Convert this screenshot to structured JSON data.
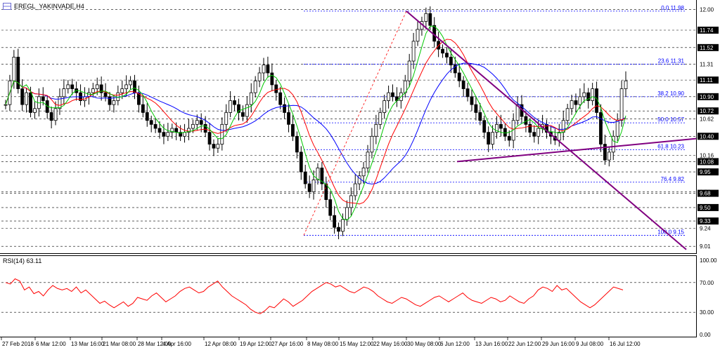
{
  "window": {
    "symbol_title": "EREGL_YAKINVADE,H4",
    "window_icon": "chart-window-icon"
  },
  "rsi": {
    "label": "RSI(14) 63.11",
    "levels": [
      {
        "text": "100.00",
        "value": 100
      },
      {
        "text": "70.00",
        "value": 70
      },
      {
        "text": "30.00",
        "value": 30
      },
      {
        "text": "0.00",
        "value": 0
      }
    ],
    "line_color": "#ff0000",
    "values": [
      70,
      68,
      75,
      72,
      60,
      64,
      55,
      58,
      52,
      60,
      66,
      62,
      60,
      62,
      58,
      64,
      56,
      60,
      54,
      48,
      42,
      45,
      40,
      36,
      40,
      44,
      38,
      42,
      50,
      48,
      46,
      52,
      56,
      50,
      44,
      48,
      52,
      58,
      62,
      64,
      60,
      56,
      58,
      64,
      68,
      72,
      64,
      58,
      52,
      48,
      44,
      40,
      34,
      30,
      28,
      32,
      38,
      36,
      42,
      48,
      44,
      38,
      42,
      46,
      52,
      58,
      62,
      66,
      70,
      68,
      64,
      66,
      62,
      58,
      56,
      60,
      64,
      62,
      58,
      52,
      48,
      44,
      42,
      46,
      50,
      48,
      44,
      40,
      38,
      42,
      46,
      50,
      52,
      48,
      44,
      48,
      52,
      56,
      50,
      46,
      44,
      42,
      46,
      50,
      48,
      44,
      46,
      52,
      48,
      44,
      42,
      48,
      52,
      60,
      64,
      62,
      58,
      66,
      60,
      62,
      56,
      50,
      44,
      40,
      36,
      40,
      46,
      52,
      58,
      64,
      62,
      60
    ]
  },
  "price_axis": {
    "labels": [
      {
        "text": "12.00",
        "value": 12.0
      },
      {
        "text": "11.74",
        "value": 11.74
      },
      {
        "text": "11.52",
        "value": 11.52
      },
      {
        "text": "11.31",
        "value": 11.31
      },
      {
        "text": "11.11",
        "value": 11.11
      },
      {
        "text": "10.90",
        "value": 10.9
      },
      {
        "text": "10.72",
        "value": 10.72
      },
      {
        "text": "10.62",
        "value": 10.62
      },
      {
        "text": "10.40",
        "value": 10.4
      },
      {
        "text": "10.16",
        "value": 10.16
      },
      {
        "text": "10.08",
        "value": 10.08
      },
      {
        "text": "9.95",
        "value": 9.95
      },
      {
        "text": "9.70",
        "value": 9.7
      },
      {
        "text": "9.68",
        "value": 9.68
      },
      {
        "text": "9.50",
        "value": 9.5
      },
      {
        "text": "9.33",
        "value": 9.33
      },
      {
        "text": "9.24",
        "value": 9.24
      },
      {
        "text": "9.01",
        "value": 9.01
      }
    ],
    "highlighted": [
      {
        "text": "11.74",
        "value": 11.74
      },
      {
        "text": "11.52",
        "value": 11.52
      },
      {
        "text": "11.11",
        "value": 11.11
      },
      {
        "text": "10.90",
        "value": 10.9
      },
      {
        "text": "10.72",
        "value": 10.72
      },
      {
        "text": "10.40",
        "value": 10.4
      },
      {
        "text": "10.08",
        "value": 10.08
      },
      {
        "text": "9.95",
        "value": 9.95
      },
      {
        "text": "9.68",
        "value": 9.68
      },
      {
        "text": "9.50",
        "value": 9.5
      },
      {
        "text": "9.33",
        "value": 9.33
      }
    ]
  },
  "fibonacci": {
    "color": "#0000ff",
    "levels": [
      {
        "text": "0.0 11.98",
        "value": 11.98
      },
      {
        "text": "23.6 11.31",
        "value": 11.31
      },
      {
        "text": "38.2 10.90",
        "value": 10.9
      },
      {
        "text": "50.0 10.57",
        "value": 10.57
      },
      {
        "text": "61.8 10.23",
        "value": 10.23
      },
      {
        "text": "76.4 9.82",
        "value": 9.82
      },
      {
        "text": "100.0 9.15",
        "value": 9.15
      }
    ]
  },
  "time_axis": {
    "labels": [
      "27 Feb 2018",
      "6 Mar 12:00",
      "13 Mar 16:00",
      "21 Mar 08:00",
      "28 Mar 12:00",
      "4 Apr 16:00",
      "12 Apr 08:00",
      "19 Apr 12:00",
      "27 Apr 16:00",
      "8 May 08:00",
      "15 May 12:00",
      "22 May 16:00",
      "30 May 08:00",
      "6 Jun 12:00",
      "13 Jun 16:00",
      "22 Jun 12:00",
      "29 Jun 16:00",
      "9 Jul 08:00",
      "16 Jul 12:00"
    ]
  },
  "colors": {
    "candle": "#000000",
    "ma_fast": "#00c800",
    "ma_mid": "#ff0000",
    "ma_slow": "#0000ff",
    "trendline": "#800080",
    "grid": "#000000"
  },
  "chart_data": {
    "type": "candlestick",
    "title": "EREGL_YAKINVADE,H4",
    "ylim": [
      8.95,
      12.05
    ],
    "close": [
      10.8,
      11.1,
      11.4,
      11.0,
      10.8,
      10.95,
      10.7,
      10.75,
      10.9,
      10.85,
      10.7,
      10.6,
      10.75,
      10.9,
      11.0,
      11.05,
      11.0,
      10.95,
      10.85,
      10.9,
      10.95,
      11.0,
      11.05,
      10.95,
      10.9,
      10.8,
      10.85,
      10.95,
      11.0,
      11.05,
      11.1,
      10.95,
      10.8,
      10.7,
      10.6,
      10.55,
      10.5,
      10.45,
      10.4,
      10.45,
      10.5,
      10.45,
      10.4,
      10.45,
      10.5,
      10.55,
      10.6,
      10.55,
      10.45,
      10.3,
      10.25,
      10.3,
      10.55,
      10.7,
      10.85,
      10.8,
      10.7,
      10.65,
      10.8,
      10.95,
      11.1,
      11.2,
      11.3,
      11.2,
      11.05,
      10.95,
      10.8,
      10.7,
      10.55,
      10.4,
      10.2,
      9.95,
      9.8,
      9.7,
      9.85,
      10.0,
      9.8,
      9.6,
      9.4,
      9.25,
      9.2,
      9.35,
      9.5,
      9.65,
      9.8,
      9.9,
      10.0,
      10.2,
      10.4,
      10.55,
      10.7,
      10.85,
      10.95,
      10.9,
      10.85,
      10.95,
      11.1,
      11.35,
      11.6,
      11.75,
      11.85,
      11.95,
      11.8,
      11.6,
      11.5,
      11.45,
      11.4,
      11.3,
      11.2,
      11.1,
      11.0,
      10.9,
      10.8,
      10.7,
      10.6,
      10.45,
      10.3,
      10.45,
      10.55,
      10.5,
      10.4,
      10.35,
      10.6,
      10.8,
      10.65,
      10.55,
      10.45,
      10.4,
      10.5,
      10.55,
      10.45,
      10.4,
      10.35,
      10.45,
      10.6,
      10.75,
      10.85,
      10.8,
      10.9,
      10.95,
      10.85,
      11.0,
      10.7,
      10.3,
      10.1,
      10.2,
      10.4,
      10.6,
      11.0,
      11.1
    ]
  }
}
